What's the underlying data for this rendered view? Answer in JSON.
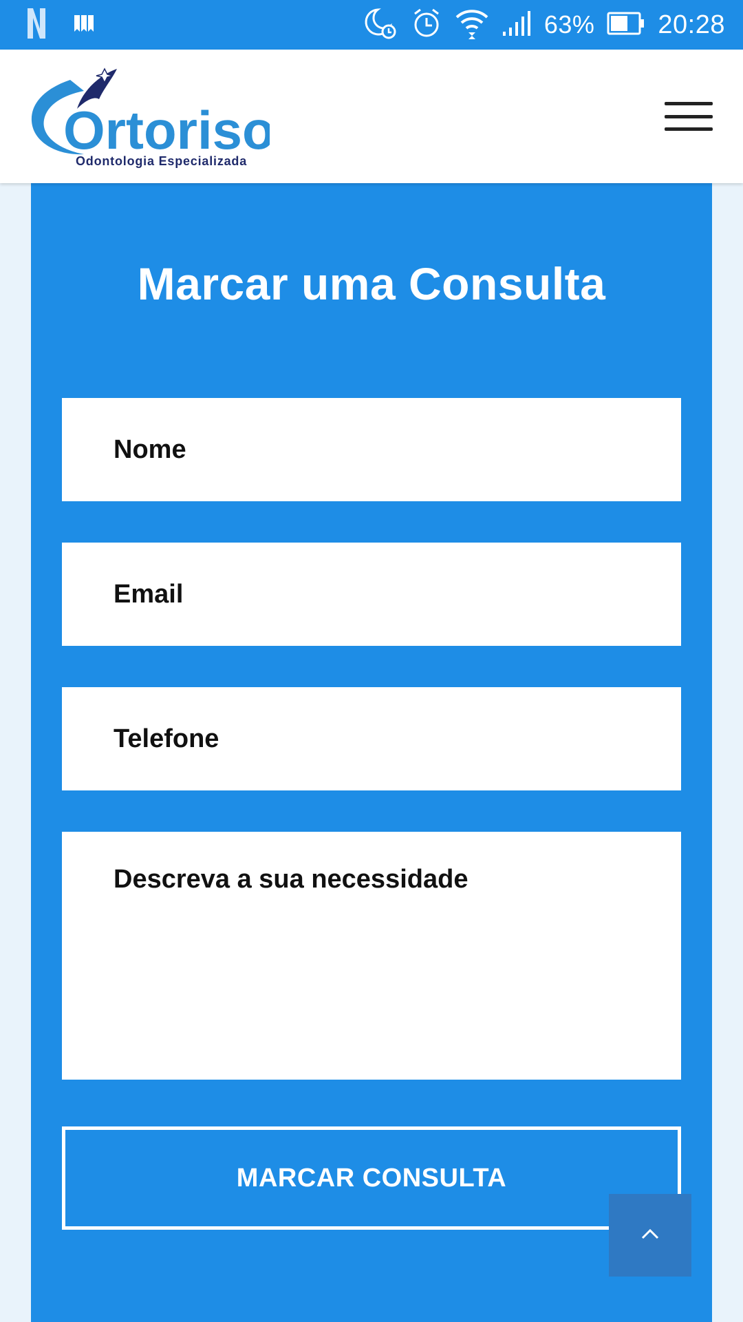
{
  "status_bar": {
    "battery_percent": "63%",
    "time": "20:28",
    "icons": [
      "netflix-icon",
      "bookmarks-icon",
      "do-not-disturb-icon",
      "alarm-icon",
      "wifi-icon",
      "signal-icon",
      "battery-icon"
    ]
  },
  "header": {
    "logo": {
      "name": "Ortoriso",
      "tagline": "Odontologia Especializada"
    },
    "menu_icon": "hamburger-menu-icon"
  },
  "form": {
    "title": "Marcar uma Consulta",
    "fields": {
      "name_placeholder": "Nome",
      "email_placeholder": "Email",
      "phone_placeholder": "Telefone",
      "description_placeholder": "Descreva a sua necessidade"
    },
    "submit_label": "MARCAR CONSULTA"
  },
  "back_to_top_icon": "chevron-up-icon",
  "colors": {
    "primary_blue": "#1e8de6",
    "page_background": "#e9f3fb",
    "logo_dark": "#1f2a6b",
    "logo_light": "#2b8fd6"
  }
}
